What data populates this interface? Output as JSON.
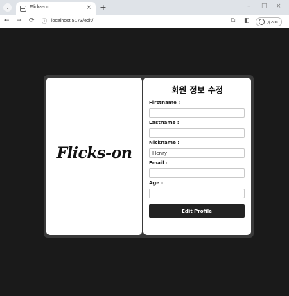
{
  "browser": {
    "tab_title": "Flicks-on",
    "tab_close": "×",
    "new_tab": "+",
    "url": "localhost:5173/edit/",
    "profile_label": "게스트",
    "menu_glyph": "⌄",
    "back": "←",
    "forward": "→",
    "reload": "⟳",
    "minimize": "–",
    "maximize": "□",
    "close": "×",
    "kebab": "⋮"
  },
  "page": {
    "logo_text": "Flicks-on",
    "form_title": "회원 정보 수정",
    "fields": [
      {
        "label": "Firstname :",
        "value": ""
      },
      {
        "label": "Lastname :",
        "value": ""
      },
      {
        "label": "Nickname :",
        "value": "Henry"
      },
      {
        "label": "Email :",
        "value": ""
      },
      {
        "label": "Age :",
        "value": ""
      }
    ],
    "submit_label": "Edit Profile"
  },
  "colors": {
    "page_background": "#1a1a1a",
    "card_background": "#3a3a3a",
    "panel_background": "#ffffff",
    "button_background": "#232323",
    "button_text": "#ffffff"
  },
  "icons": {
    "tab_favicon": "favicon-icon",
    "url_info": "info-icon",
    "translate": "translate-icon",
    "sidepanel": "sidepanel-icon",
    "profile": "profile-icon"
  }
}
